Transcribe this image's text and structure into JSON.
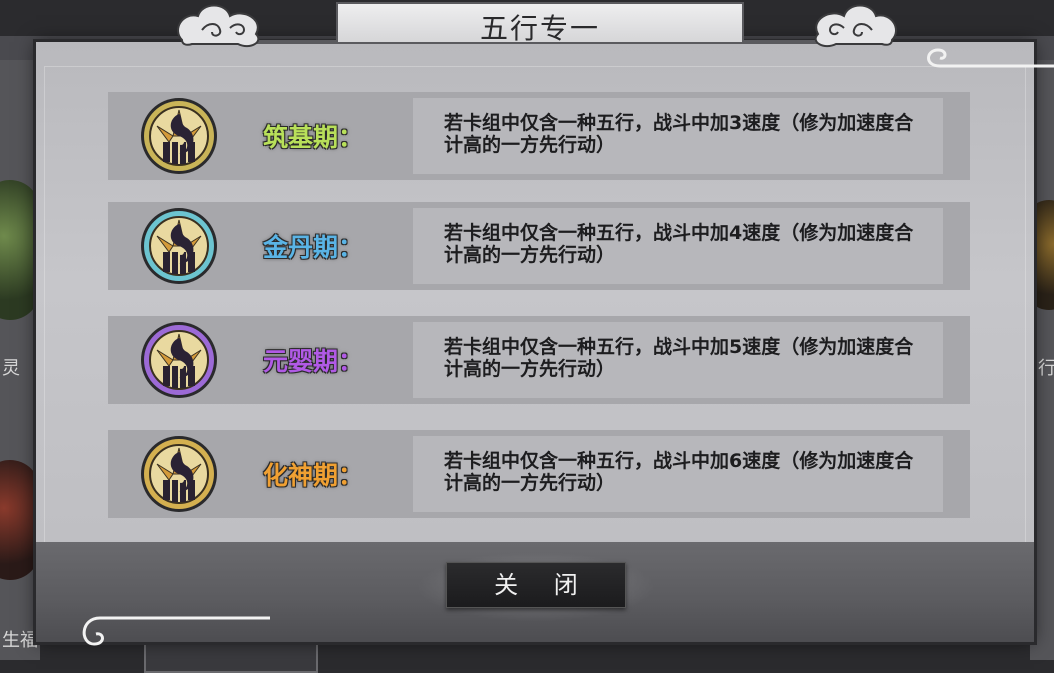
{
  "dialog": {
    "title": "五行专一",
    "close_label": "关 闭"
  },
  "background": {
    "left_text_1": "灵",
    "left_text_2": "生福",
    "right_text": "行"
  },
  "realms": [
    {
      "name": "筑基期：",
      "color": "#b8e05a",
      "medal_ring": "#c9b458",
      "description": "若卡组中仅含一种五行，战斗中加3速度（修为加速度合计高的一方先行动）"
    },
    {
      "name": "金丹期：",
      "color": "#5ab4e6",
      "medal_ring": "#6cc4d0",
      "description": "若卡组中仅含一种五行，战斗中加4速度（修为加速度合计高的一方先行动）"
    },
    {
      "name": "元婴期：",
      "color": "#b15ae6",
      "medal_ring": "#9c6ad6",
      "description": "若卡组中仅含一种五行，战斗中加5速度（修为加速度合计高的一方先行动）"
    },
    {
      "name": "化神期：",
      "color": "#f0a032",
      "medal_ring": "#d4b050",
      "description": "若卡组中仅含一种五行，战斗中加6速度（修为加速度合计高的一方先行动）"
    }
  ]
}
